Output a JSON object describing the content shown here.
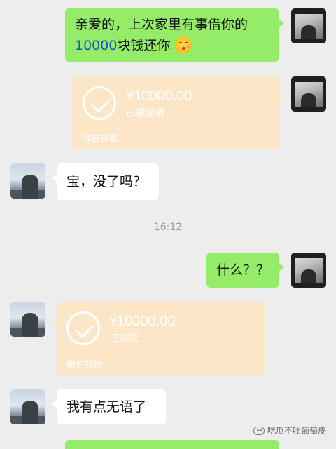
{
  "messages": {
    "m1": {
      "line1": "亲爱的，上次家里有事借你的",
      "line2_number": "10000",
      "line2_text": "块钱还你",
      "emoji": "kissing-face-emoji"
    },
    "t1": {
      "amount": "¥10000.00",
      "status": "已被接收",
      "footer": "微信转账"
    },
    "m2": {
      "text": "宝，没了吗？"
    },
    "timestamp": "16:12",
    "m3": {
      "text": "什么？？"
    },
    "t2": {
      "amount": "¥10000.00",
      "status": "已收款",
      "footer": "微信转账"
    },
    "m4": {
      "text": "我有点无语了"
    }
  },
  "watermark": {
    "text": "吃瓜不吐葡萄皮"
  },
  "colors": {
    "background": "#ededed",
    "sent_bubble": "#95ec69",
    "received_bubble": "#ffffff",
    "transfer_card": "#fce6c8",
    "number_link": "#1a56b8",
    "timestamp": "#9a9a9a"
  }
}
